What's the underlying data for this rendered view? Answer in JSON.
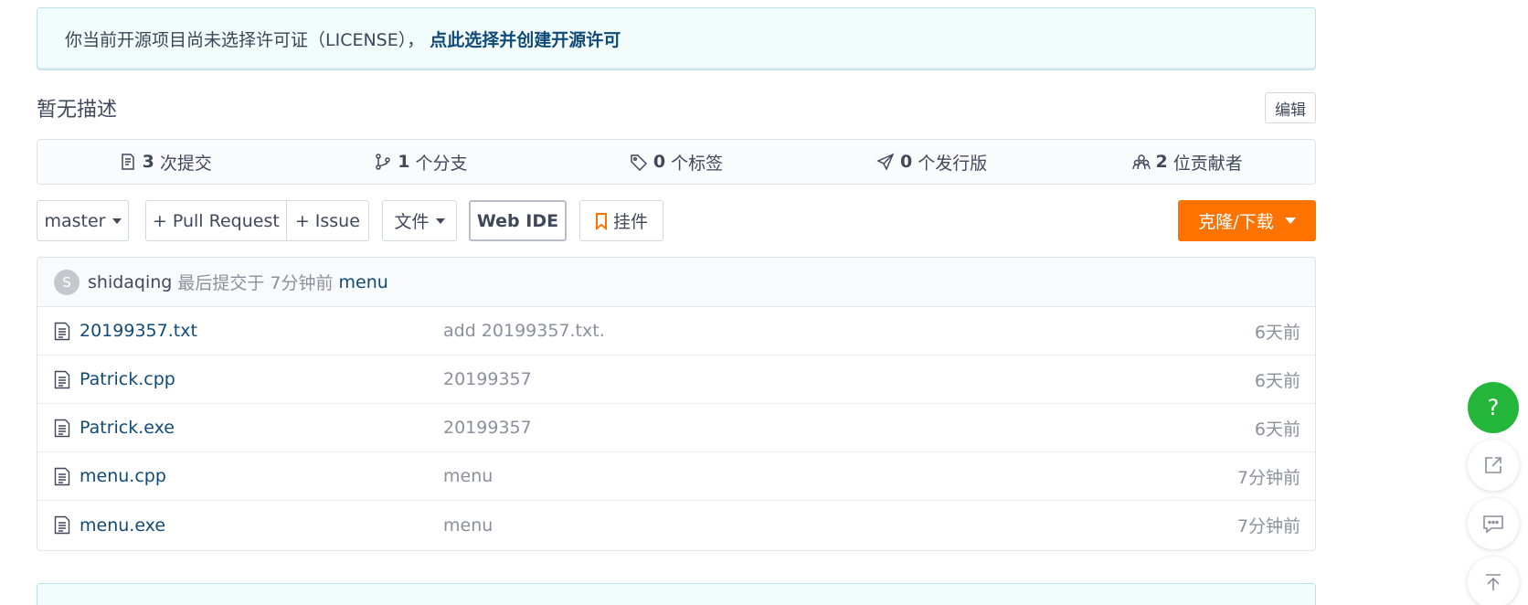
{
  "license_notice": {
    "text": "你当前开源项目尚未选择许可证（LICENSE），",
    "link_label": "点此选择并创建开源许可"
  },
  "description": {
    "text": "暂无描述",
    "edit_label": "编辑"
  },
  "stats": [
    {
      "icon": "commit-icon",
      "count": "3",
      "label": "次提交"
    },
    {
      "icon": "branch-icon",
      "count": "1",
      "label": "个分支"
    },
    {
      "icon": "tag-icon",
      "count": "0",
      "label": "个标签"
    },
    {
      "icon": "release-icon",
      "count": "0",
      "label": "个发行版"
    },
    {
      "icon": "contributors-icon",
      "count": "2",
      "label": "位贡献者"
    }
  ],
  "toolbar": {
    "branch_label": "master",
    "pull_request_label": "+ Pull Request",
    "issue_label": "+ Issue",
    "file_label": "文件",
    "webide_label": "Web IDE",
    "widget_label": "挂件",
    "clone_label": "克隆/下载"
  },
  "last_commit": {
    "avatar_initial": "S",
    "author": "shidaqing",
    "meta": "最后提交于 7分钟前",
    "message": "menu"
  },
  "files": [
    {
      "name": "20199357.txt",
      "commit": "add 20199357.txt.",
      "time": "6天前"
    },
    {
      "name": "Patrick.cpp",
      "commit": "20199357",
      "time": "6天前"
    },
    {
      "name": "Patrick.exe",
      "commit": "20199357",
      "time": "6天前"
    },
    {
      "name": "menu.cpp",
      "commit": "menu",
      "time": "7分钟前"
    },
    {
      "name": "menu.exe",
      "commit": "menu",
      "time": "7分钟前"
    }
  ],
  "floating": {
    "help_label": "?"
  },
  "colors": {
    "accent_orange": "#fe7300",
    "link_blue": "#0f4a78",
    "help_green": "#24b53b"
  }
}
